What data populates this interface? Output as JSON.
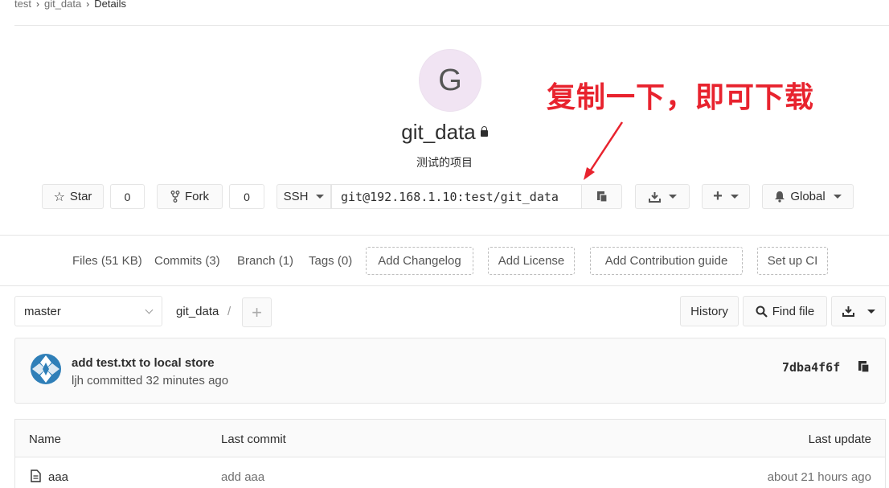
{
  "breadcrumb": {
    "items": [
      "test",
      "git_data"
    ],
    "current": "Details"
  },
  "project": {
    "avatar_letter": "G",
    "name": "git_data",
    "description": "测试的项目"
  },
  "annotation": {
    "text": "复制一下，即可下载",
    "color": "#e8232e"
  },
  "actions": {
    "star_label": "Star",
    "star_count": "0",
    "fork_label": "Fork",
    "fork_count": "0",
    "protocol": "SSH",
    "clone_url": "git@192.168.1.10:test/git_data",
    "notification": "Global"
  },
  "stats": {
    "files": "Files (51 KB)",
    "commits": "Commits (3)",
    "branch": "Branch (1)",
    "tags": "Tags (0)",
    "add_changelog": "Add Changelog",
    "add_license": "Add License",
    "add_contribution": "Add Contribution guide",
    "setup_ci": "Set up CI"
  },
  "tree": {
    "branch": "master",
    "path": "git_data",
    "path_sep": "/",
    "history": "History",
    "find_file": "Find file"
  },
  "last_commit": {
    "title": "add test.txt to local store",
    "meta": "ljh committed 32 minutes ago",
    "sha": "7dba4f6f"
  },
  "table": {
    "headers": {
      "name": "Name",
      "last_commit": "Last commit",
      "last_update": "Last update"
    },
    "rows": [
      {
        "name": "aaa",
        "commit": "add aaa",
        "updated": "about 21 hours ago"
      }
    ]
  }
}
